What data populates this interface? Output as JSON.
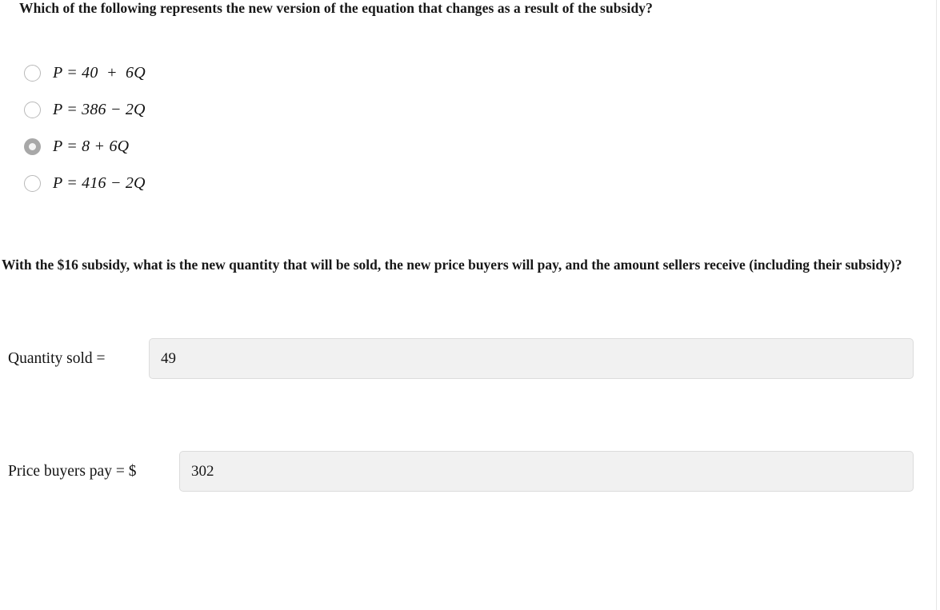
{
  "question_one": {
    "prompt": "Which of the following represents the new version of the equation that changes as a result of the subsidy?",
    "options": [
      {
        "id": "option-a",
        "label": "P = 40  +  6Q",
        "selected": false
      },
      {
        "id": "option-b",
        "label": "P = 386 − 2Q",
        "selected": false
      },
      {
        "id": "option-c",
        "label": "P = 8 + 6Q",
        "selected": true
      },
      {
        "id": "option-d",
        "label": "P = 416 − 2Q",
        "selected": false
      }
    ]
  },
  "question_two": {
    "prompt": "With the $16 subsidy, what is the new quantity that will be sold, the new price buyers will pay, and the amount sellers receive (including their subsidy)?",
    "fields": [
      {
        "id": "quantity-sold",
        "label": "Quantity sold =",
        "value": "49",
        "placeholder": ""
      },
      {
        "id": "price-buyers-pay",
        "label": "Price buyers pay = $",
        "value": "302",
        "placeholder": ""
      }
    ]
  },
  "colors": {
    "page_background": "#ffffff",
    "text": "#181818",
    "input_fill": "#f1f1f1",
    "input_border": "#dcdcdc",
    "radio_border": "#b9b9b9",
    "radio_selected_fill": "#a8a8a8",
    "divider": "#e6e6e6"
  }
}
